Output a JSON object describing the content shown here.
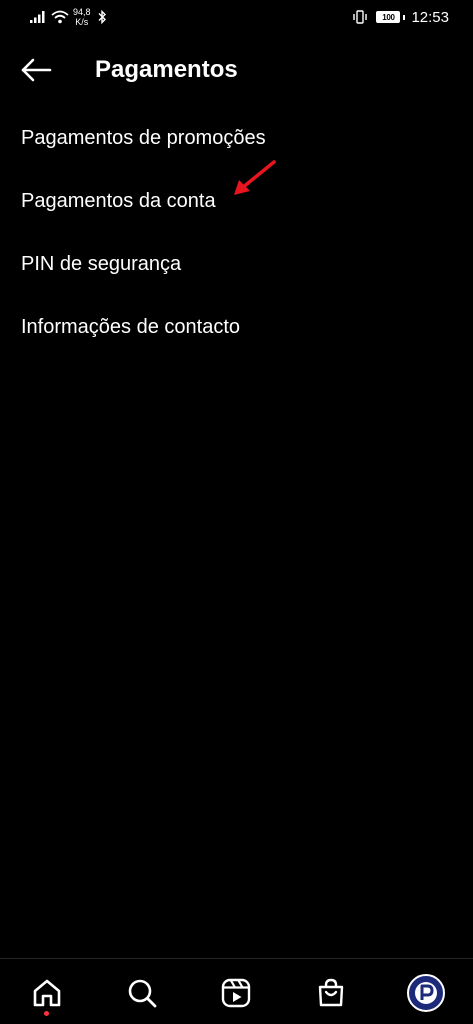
{
  "status_bar": {
    "network_speed_value": "94,8",
    "network_speed_unit": "K/s",
    "battery": "100",
    "time": "12:53"
  },
  "header": {
    "title": "Pagamentos"
  },
  "menu": {
    "items": [
      {
        "label": "Pagamentos de promoções"
      },
      {
        "label": "Pagamentos da conta"
      },
      {
        "label": "PIN de segurança"
      },
      {
        "label": "Informações de contacto"
      }
    ]
  },
  "annotation": {
    "arrow_color": "#e8141e"
  },
  "bottom_nav": {
    "items": [
      "home-icon",
      "search-icon",
      "reels-icon",
      "shop-icon",
      "profile-avatar"
    ],
    "active": "home-icon",
    "notification_dot_color": "#ff3040",
    "avatar_color": "#1d2a7a"
  }
}
